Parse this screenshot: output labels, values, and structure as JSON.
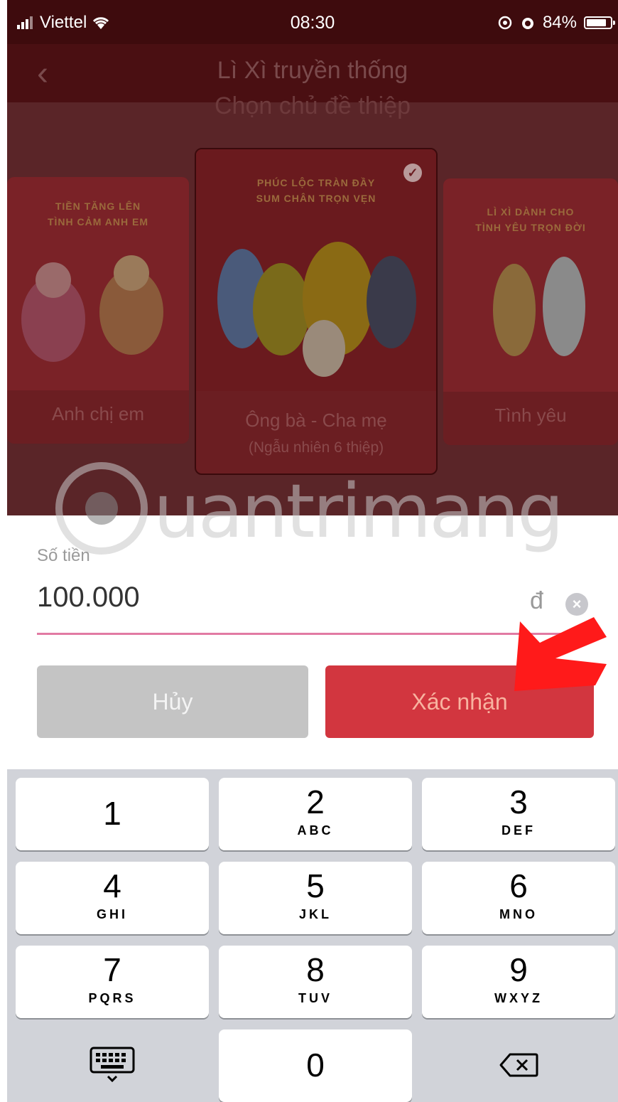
{
  "status_bar": {
    "carrier": "Viettel",
    "time": "08:30",
    "battery": "84%",
    "battery_level": 0.84
  },
  "nav": {
    "title": "Lì Xì truyền thống"
  },
  "section_title": "Chọn chủ đề thiệp",
  "cards": [
    {
      "caption": "Anh chị em",
      "greeting": "TIỀN TĂNG LÊN\nTÌNH CẢM ANH EM"
    },
    {
      "caption": "Ông bà - Cha mẹ",
      "subcaption": "(Ngẫu nhiên 6 thiệp)",
      "greeting": "PHÚC LỘC TRÀN ĐẦY\nSUM CHÂN TRỌN VẸN",
      "selected": true
    },
    {
      "caption": "Tình yêu",
      "greeting": "LÌ XÌ DÀNH CHO\nTÌNH YÊU TRỌN ĐỜI"
    }
  ],
  "watermark": {
    "text": "uantrimang"
  },
  "form": {
    "amount_label": "Số tiền",
    "amount_value": "100.000",
    "currency": "đ",
    "cancel_label": "Hủy",
    "confirm_label": "Xác nhận"
  },
  "keypad": {
    "keys": [
      {
        "num": "1",
        "letters": ""
      },
      {
        "num": "2",
        "letters": "ABC"
      },
      {
        "num": "3",
        "letters": "DEF"
      },
      {
        "num": "4",
        "letters": "GHI"
      },
      {
        "num": "5",
        "letters": "JKL"
      },
      {
        "num": "6",
        "letters": "MNO"
      },
      {
        "num": "7",
        "letters": "PQRS"
      },
      {
        "num": "8",
        "letters": "TUV"
      },
      {
        "num": "9",
        "letters": "WXYZ"
      }
    ],
    "zero": "0"
  },
  "icons": {
    "back": "chevron-left-icon",
    "check": "check-circle-icon",
    "clear": "clear-icon",
    "keyboard": "keyboard-icon",
    "backspace": "backspace-icon",
    "arrow": "red-arrow-icon"
  },
  "colors": {
    "confirm": "#d2363f",
    "cancel": "#c4c4c4",
    "underline": "#e27aa3",
    "arrow": "#ff1a1a"
  }
}
